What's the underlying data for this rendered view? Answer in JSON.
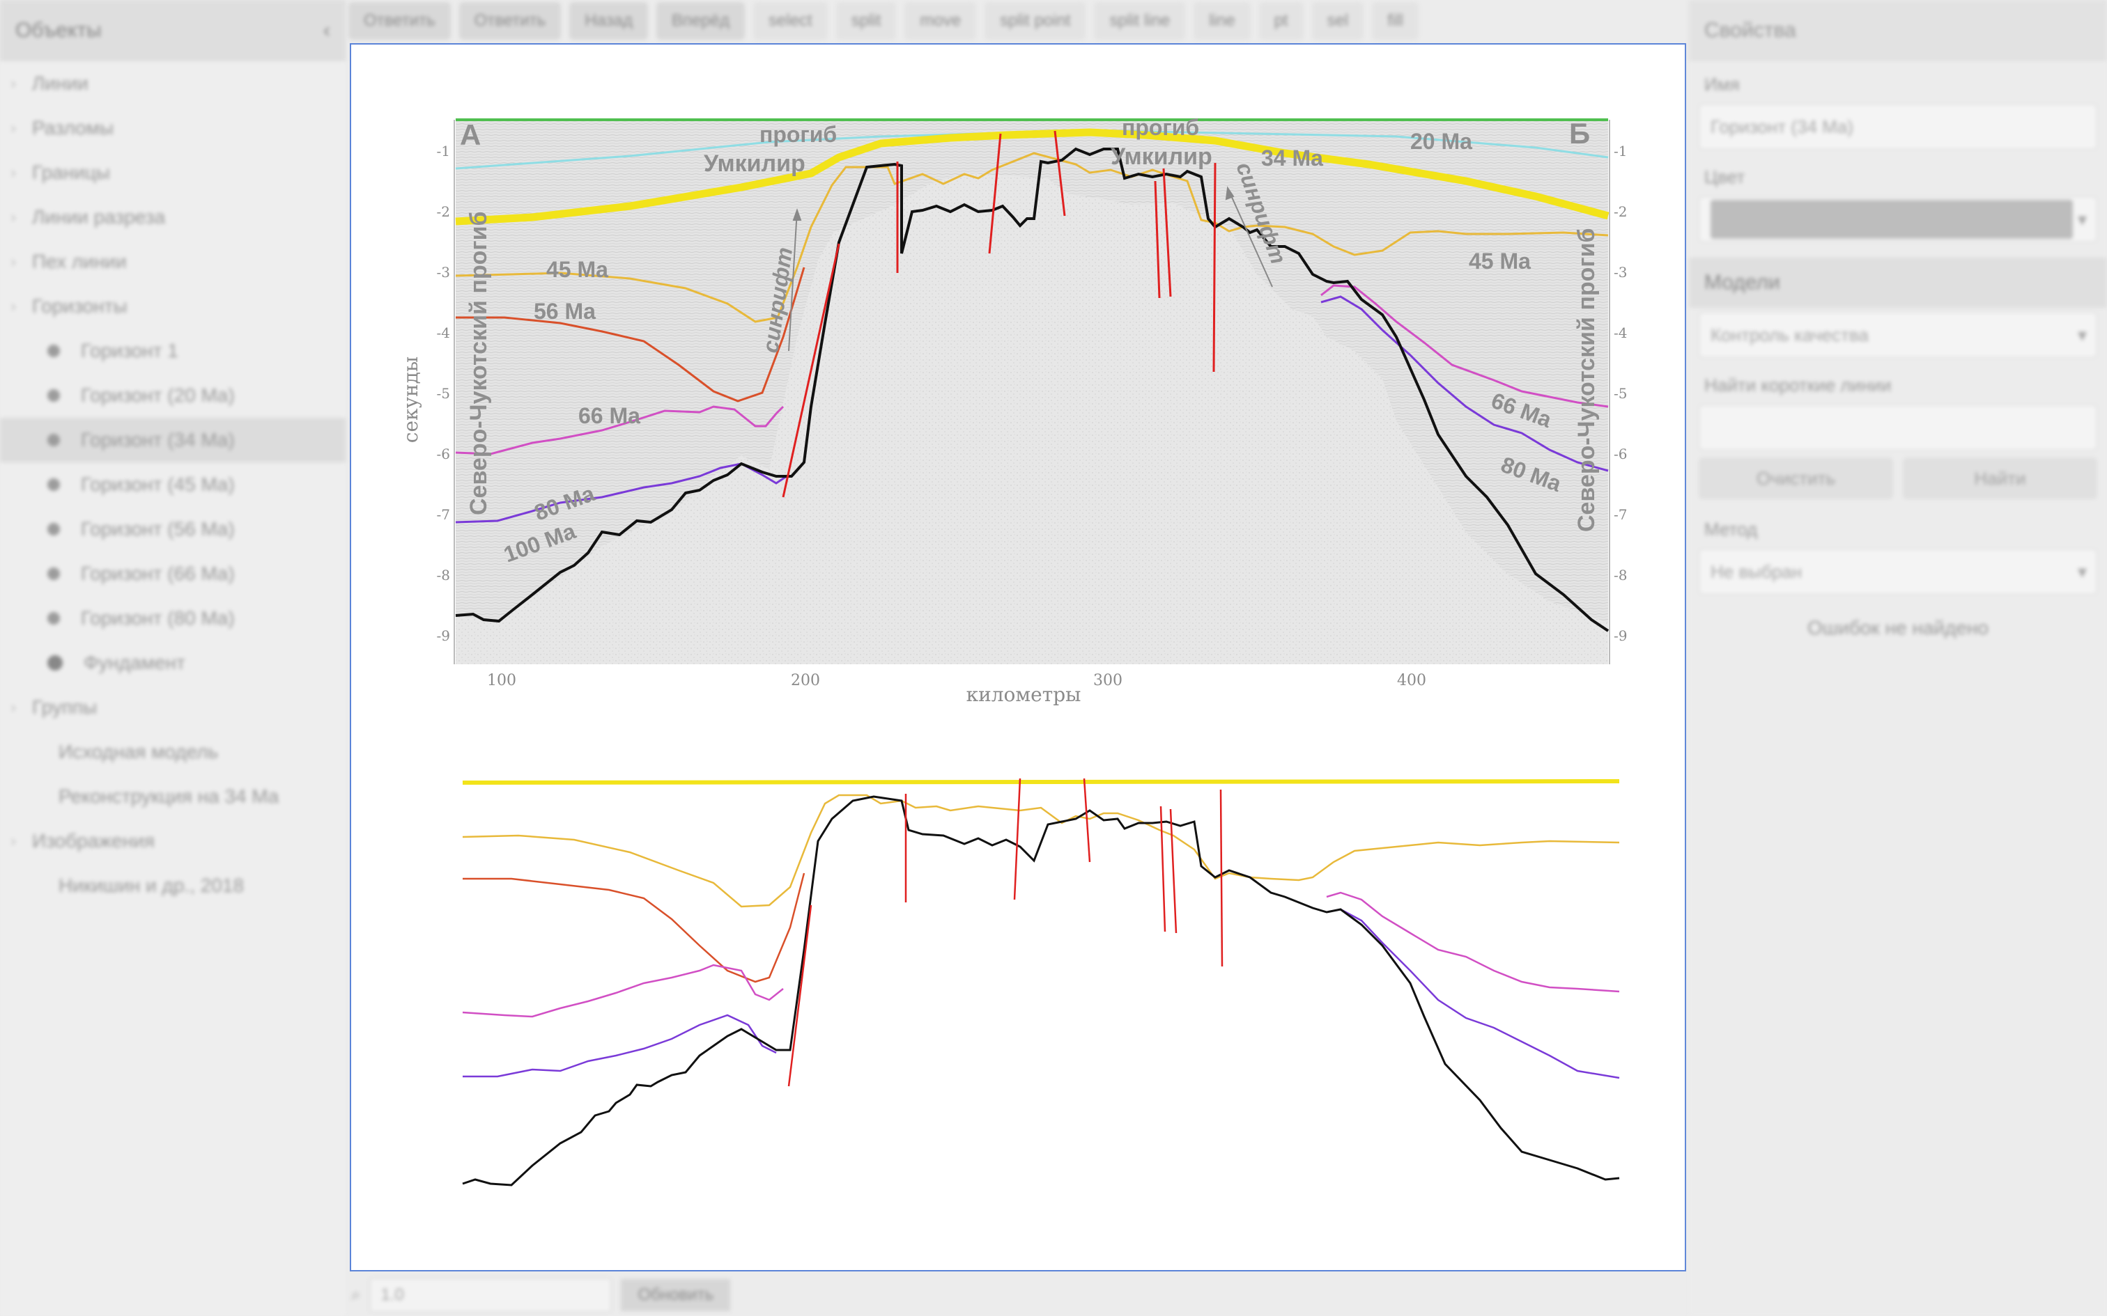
{
  "sidebar": {
    "title": "Объекты",
    "items": [
      {
        "label": "Линии",
        "level": 0
      },
      {
        "label": "Разломы",
        "level": 0
      },
      {
        "label": "Границы",
        "level": 0
      },
      {
        "label": "Линии разреза",
        "level": 0
      },
      {
        "label": "Пех линии",
        "level": 0
      },
      {
        "label": "Горизонты",
        "level": 0
      },
      {
        "label": "Горизонт 1",
        "level": 1
      },
      {
        "label": "Горизонт (20 Ma)",
        "level": 1
      },
      {
        "label": "Горизонт (34 Ma)",
        "level": 1,
        "selected": true
      },
      {
        "label": "Горизонт (45 Ma)",
        "level": 1
      },
      {
        "label": "Горизонт (56 Ma)",
        "level": 1
      },
      {
        "label": "Горизонт (66 Ma)",
        "level": 1
      },
      {
        "label": "Горизонт (80 Ma)",
        "level": 1
      },
      {
        "label": "Фундамент",
        "level": 1
      },
      {
        "label": "Группы",
        "level": 0
      },
      {
        "label": "Исходная модель",
        "level": 1
      },
      {
        "label": "Реконструкция на 34 Ma",
        "level": 1
      },
      {
        "label": "Изображения",
        "level": 0
      },
      {
        "label": "Никишин и др., 2018",
        "level": 1
      }
    ]
  },
  "toolbar": {
    "buttons": [
      "Ответить",
      "Ответить",
      "Назад",
      "Вперёд",
      "select",
      "split",
      "move",
      "split point",
      "split line",
      "line",
      "pt",
      "sel",
      "fill"
    ]
  },
  "properties": {
    "title": "Свойства",
    "name_label": "Имя",
    "name_value": "Горизонт (34 Ma)",
    "color_label": "Цвет",
    "color_value": "#bdbdbd",
    "model_section": "Модели",
    "model_select": "Контроль качества",
    "find_label": "Найти короткие линии",
    "find_value": "",
    "btn_clear": "Очистить",
    "btn_find": "Найти",
    "method_label": "Метод",
    "method_select": "Не выбран",
    "message": "Ошибок не найдено"
  },
  "bottom": {
    "input_value": "1.0",
    "button": "Обновить"
  },
  "figure": {
    "corner_left": "А",
    "corner_right": "Б",
    "trough_top": "прогиб",
    "trough_name": "Умкилир",
    "trough_top_right": "прогиб",
    "trough_name_right": "Умкилир",
    "synrift_left": "синрифт",
    "synrift_right": "синрифт",
    "basin_left": "Северо-Чукотский прогиб",
    "basin_right": "Северо-Чукотский прогиб",
    "ages_left": [
      "45 Ma",
      "56 Ma",
      "66 Ma",
      "80 Ma",
      "100 Ma"
    ],
    "ages_right": [
      "20 Ma",
      "34 Ma",
      "45 Ma",
      "66 Ma",
      "80 Ma"
    ],
    "ylabel": "секунды",
    "xlabel": "километры",
    "y_ticks": [
      "-1",
      "-2",
      "-3",
      "-4",
      "-5",
      "-6",
      "-7",
      "-8",
      "-9"
    ],
    "x_ticks": [
      "100",
      "200",
      "300",
      "400"
    ],
    "colors": {
      "yellow": "#f2e31a",
      "orange": "#e8b93a",
      "red": "#d9502a",
      "magenta": "#d14fc4",
      "purple": "#7a3ad8",
      "black": "#111111",
      "fault": "#e02020",
      "cyan": "#74d8e0",
      "green": "#4fbf4f"
    }
  }
}
